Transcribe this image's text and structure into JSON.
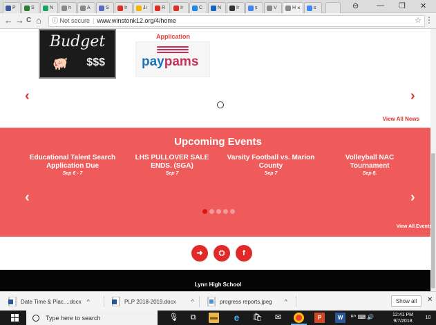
{
  "browser": {
    "tabs": [
      {
        "label": "P",
        "color": "#3b5998"
      },
      {
        "label": "S",
        "color": "#2e7d32"
      },
      {
        "label": "N",
        "color": "#1aa260"
      },
      {
        "label": "h",
        "color": "#888888"
      },
      {
        "label": "A",
        "color": "#888888"
      },
      {
        "label": "S",
        "color": "#5c6bc0"
      },
      {
        "label": "Ir",
        "color": "#d93025"
      },
      {
        "label": "Ji",
        "color": "#f4b400"
      },
      {
        "label": "R",
        "color": "#d93025"
      },
      {
        "label": "Ir",
        "color": "#d93025"
      },
      {
        "label": "C",
        "color": "#1e88e5"
      },
      {
        "label": "N",
        "color": "#1565c0"
      },
      {
        "label": "Ir",
        "color": "#333333"
      },
      {
        "label": "s",
        "color": "#4285f4"
      },
      {
        "label": "V",
        "color": "#888888"
      },
      {
        "label": "H",
        "color": "#888888"
      },
      {
        "label": "s",
        "color": "#4285f4"
      }
    ],
    "active_tab_close": "×",
    "window_controls": {
      "user": "⊖",
      "minimize": "—",
      "maximize": "❐",
      "close": "✕"
    },
    "nav": {
      "back": "←",
      "forward": "→",
      "reload": "C",
      "home": "⌂"
    },
    "security": "ⓘ Not secure",
    "url": "www.winstonk12.org/4/home",
    "star": "☆",
    "menu": "⋮"
  },
  "page": {
    "news": {
      "budget_title": "Budget",
      "budget_money": "$$$",
      "application_label": "Application",
      "paypams_word_a": "pay",
      "paypams_word_b": "pams",
      "prev": "‹",
      "next": "›",
      "view_all": "View All News"
    },
    "events": {
      "title": "Upcoming Events",
      "items": [
        {
          "name": "Educational Talent Search Application Due",
          "date": "Sep 6 - 7"
        },
        {
          "name": "LHS PULLOVER SALE ENDS. (SGA)",
          "date": "Sep 7"
        },
        {
          "name": "Varsity Football vs. Marion County",
          "date": "Sep 7"
        },
        {
          "name": "Volleyball NAC Tournament",
          "date": "Sep 8."
        }
      ],
      "prev": "‹",
      "next": "›",
      "view_all": "View All Events"
    },
    "social": {
      "login": "➜",
      "sitemap": "⛭",
      "facebook": "f"
    },
    "footer": {
      "school": "Lynn High School"
    }
  },
  "downloads": {
    "items": [
      {
        "name": "Date Time & Plac....docx",
        "type": "word"
      },
      {
        "name": "PLP 2018-2019.docx",
        "type": "word"
      },
      {
        "name": "progress reports.jpeg",
        "type": "image"
      }
    ],
    "chevron": "^",
    "show_all": "Show all",
    "close": "✕"
  },
  "taskbar": {
    "search_placeholder": "Type here to search",
    "time": "12:41 PM",
    "date": "9/7/2018",
    "tray_text": "ᴿ^  ⌨ 🔊",
    "notifications": "10"
  }
}
